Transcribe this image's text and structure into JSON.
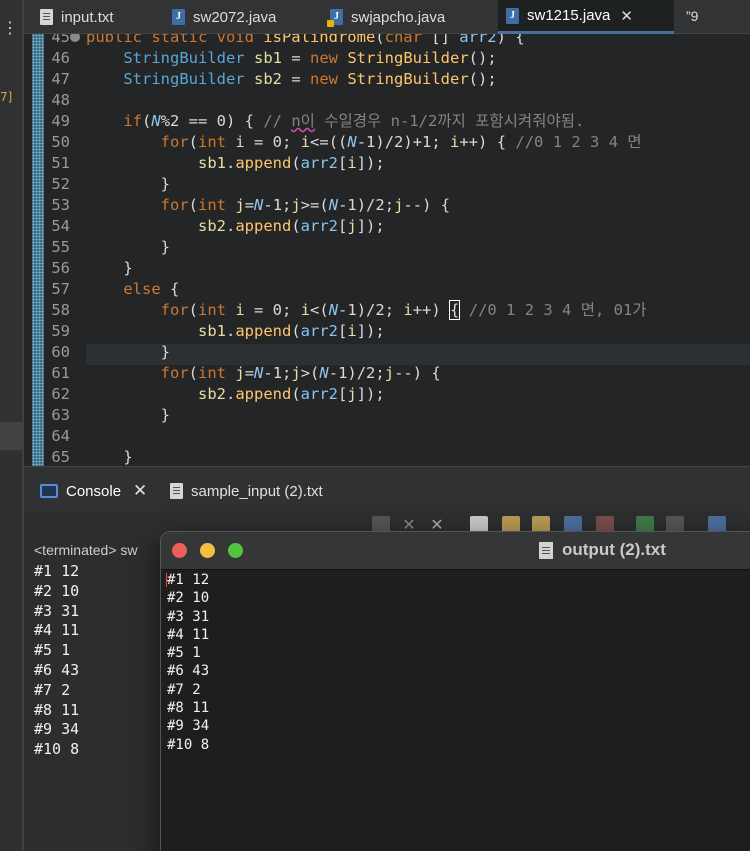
{
  "editor_tabs": [
    {
      "label": "input.txt",
      "icon": "text-file-icon"
    },
    {
      "label": "sw2072.java",
      "icon": "java-file-icon"
    },
    {
      "label": "swjapcho.java",
      "icon": "java-file-warning-icon"
    },
    {
      "label": "sw1215.java",
      "icon": "java-file-icon",
      "active": true
    }
  ],
  "tab_overflow": "”9",
  "code": [
    {
      "n": "45",
      "t": "public static void isPalindrome(char [] arr2) {"
    },
    {
      "n": "46",
      "t": "    StringBuilder sb1 = new StringBuilder();"
    },
    {
      "n": "47",
      "t": "    StringBuilder sb2 = new StringBuilder();"
    },
    {
      "n": "48",
      "t": ""
    },
    {
      "n": "49",
      "t": "    if(N%2 == 0) { // n이 수일경우 n-1/2까지 포함시켜줘야됨."
    },
    {
      "n": "50",
      "t": "        for(int i = 0; i<=((N-1)/2)+1; i++) { //0 1 2 3 4 면"
    },
    {
      "n": "51",
      "t": "            sb1.append(arr2[i]);"
    },
    {
      "n": "52",
      "t": "        }"
    },
    {
      "n": "53",
      "t": "        for(int j=N-1;j>=(N-1)/2;j--) {"
    },
    {
      "n": "54",
      "t": "            sb2.append(arr2[j]);"
    },
    {
      "n": "55",
      "t": "        }"
    },
    {
      "n": "56",
      "t": "    }"
    },
    {
      "n": "57",
      "t": "    else {"
    },
    {
      "n": "58",
      "t": "        for(int i = 0; i<(N-1)/2; i++) { //0 1 2 3 4 면, 01가"
    },
    {
      "n": "59",
      "t": "            sb1.append(arr2[i]);"
    },
    {
      "n": "60",
      "t": "        }"
    },
    {
      "n": "61",
      "t": "        for(int j=N-1;j>(N-1)/2;j--) {"
    },
    {
      "n": "62",
      "t": "            sb2.append(arr2[j]);"
    },
    {
      "n": "63",
      "t": "        }"
    },
    {
      "n": "64",
      "t": ""
    },
    {
      "n": "65",
      "t": "    }"
    }
  ],
  "console": {
    "tab_label": "Console",
    "second_tab_label": "sample_input (2).txt",
    "terminated": "<terminated> sw",
    "lines": [
      "#1 12",
      "#2 10",
      "#3 31",
      "#4 11",
      "#5 1",
      "#6 43",
      "#7 2",
      "#8 11",
      "#9 34",
      "#10 8"
    ]
  },
  "output_window": {
    "title": "output (2).txt",
    "lines": [
      "#1 12",
      "#2 10",
      "#3 31",
      "#4 11",
      "#5 1",
      "#6 43",
      "#7 2",
      "#8 11",
      "#9 34",
      "#10 8"
    ]
  }
}
